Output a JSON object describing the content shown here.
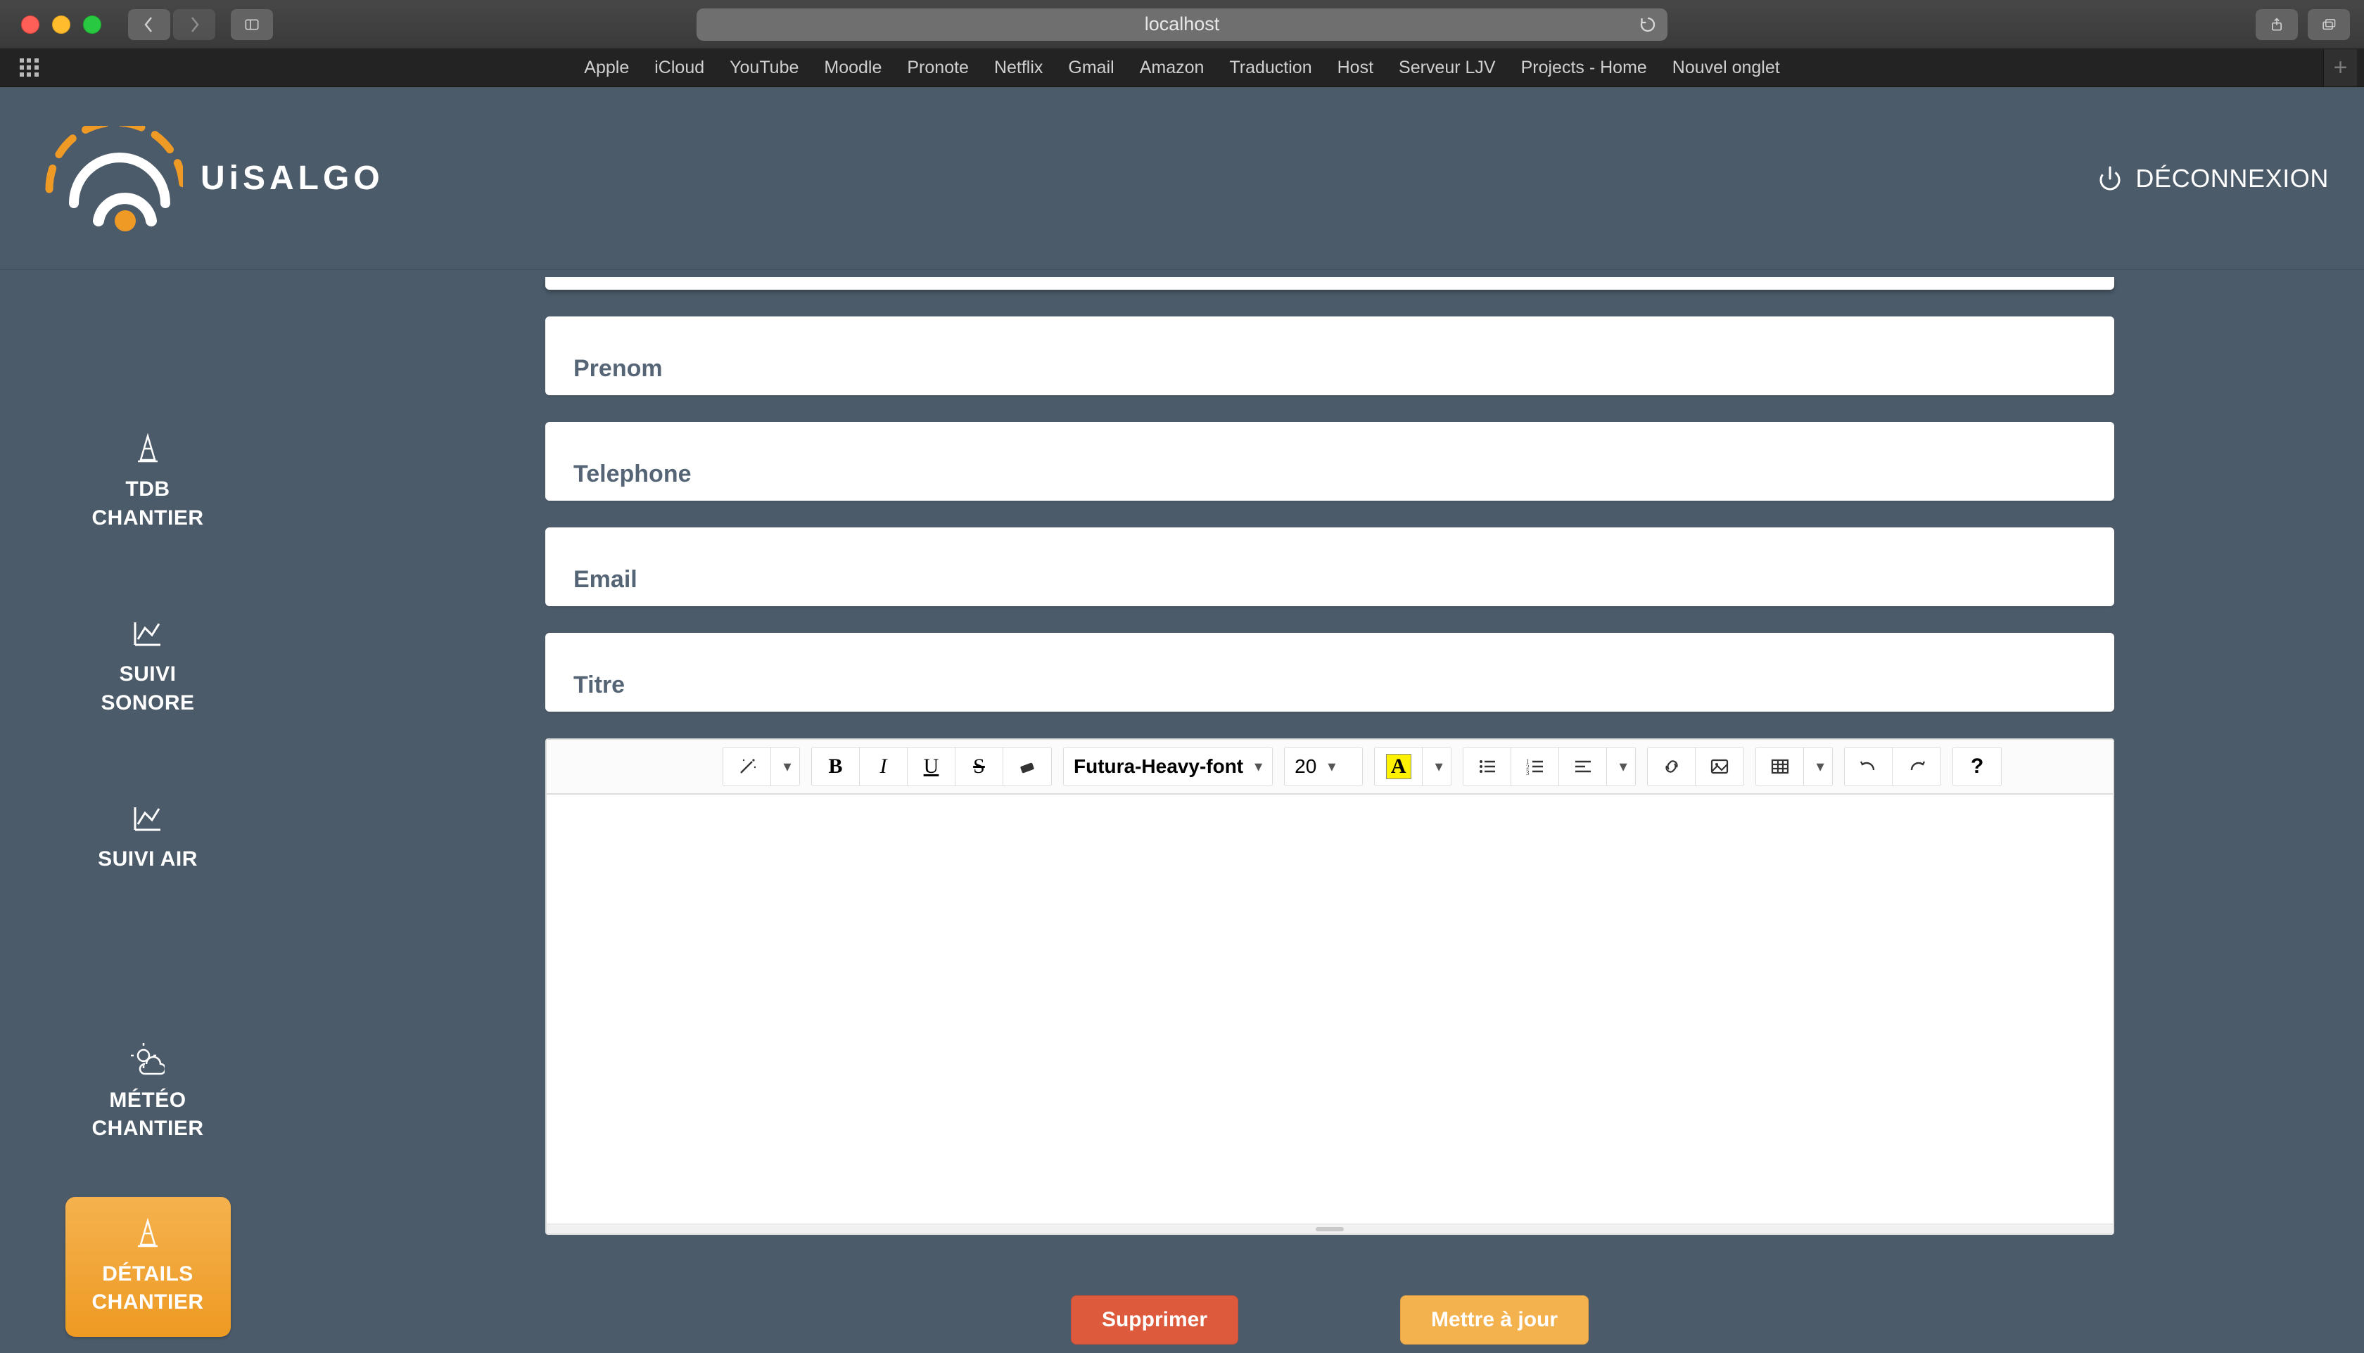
{
  "browser": {
    "url": "localhost",
    "favorites": [
      "Apple",
      "iCloud",
      "YouTube",
      "Moodle",
      "Pronote",
      "Netflix",
      "Gmail",
      "Amazon",
      "Traduction",
      "Host",
      "Serveur LJV",
      "Projects - Home",
      "Nouvel onglet"
    ]
  },
  "header": {
    "brand_text": "UiSALGO",
    "logout_label": "DÉCONNEXION"
  },
  "nav": {
    "items": [
      {
        "id": "tdb",
        "label_l1": "TDB",
        "label_l2": "CHANTIER",
        "icon": "cone-icon"
      },
      {
        "id": "sonore",
        "label_l1": "SUIVI",
        "label_l2": "SONORE",
        "icon": "chart-icon"
      },
      {
        "id": "air",
        "label_l1": "SUIVI AIR",
        "label_l2": "",
        "icon": "chart-icon"
      },
      {
        "id": "meteo",
        "label_l1": "MÉTÉO",
        "label_l2": "CHANTIER",
        "icon": "weather-icon"
      },
      {
        "id": "details",
        "label_l1": "DÉTAILS",
        "label_l2": "CHANTIER",
        "icon": "cone-icon",
        "active": true
      }
    ]
  },
  "form": {
    "fields": {
      "prenom": {
        "label": "Prenom",
        "value": ""
      },
      "telephone": {
        "label": "Telephone",
        "value": ""
      },
      "email": {
        "label": "Email",
        "value": ""
      },
      "titre": {
        "label": "Titre",
        "value": ""
      }
    }
  },
  "editor": {
    "font_name": "Futura-Heavy-font",
    "font_size": "20",
    "text_color_glyph": "A",
    "content": ""
  },
  "actions": {
    "delete_label": "Supprimer",
    "update_label": "Mettre à jour"
  }
}
